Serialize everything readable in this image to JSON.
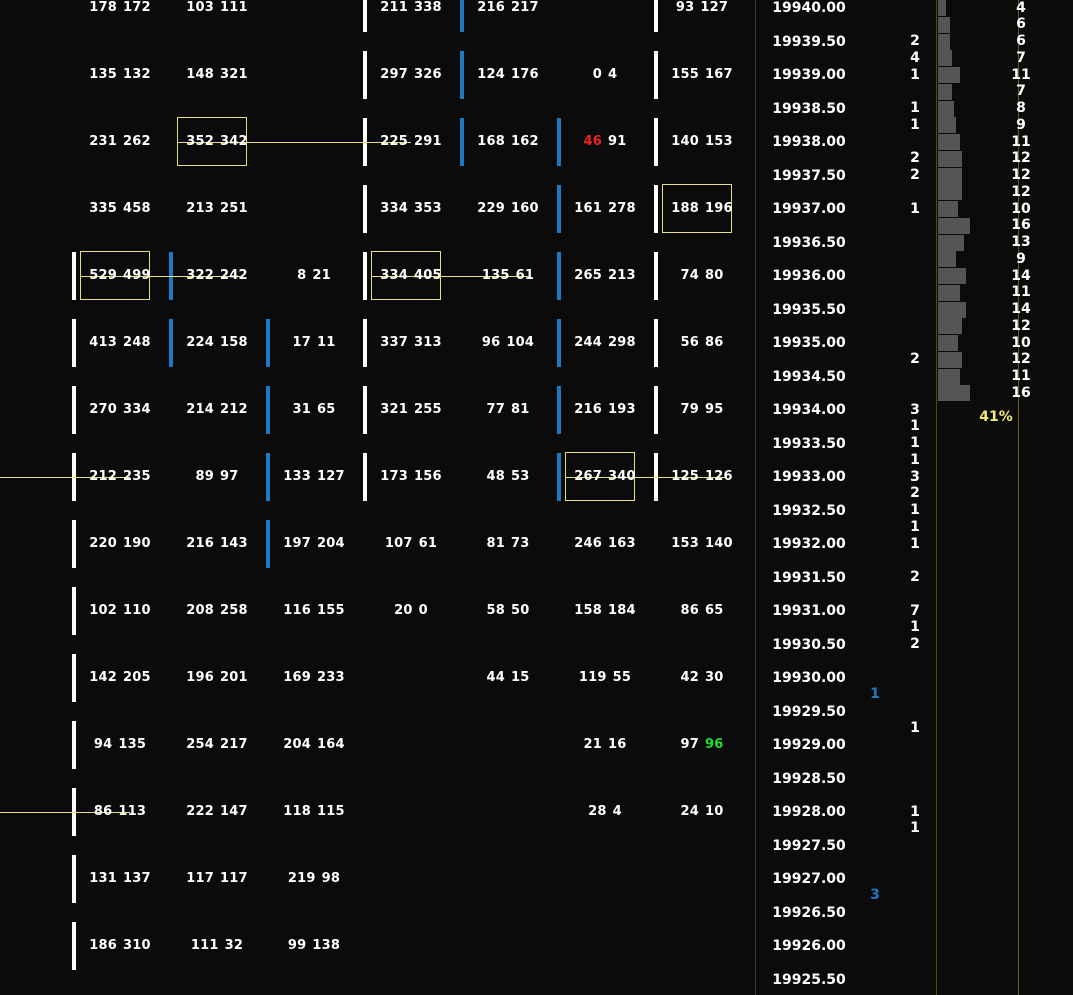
{
  "columns": [
    {
      "rows": [
        {
          "price": "19940.00",
          "bid": "178",
          "ask": "172"
        },
        {
          "price": "19939.00",
          "bid": "135",
          "ask": "132"
        },
        {
          "price": "19938.00",
          "bid": "231",
          "ask": "262"
        },
        {
          "price": "19937.00",
          "bid": "335",
          "ask": "458"
        },
        {
          "price": "19936.00",
          "bid": "529",
          "ask": "499",
          "box": true,
          "line_across": true,
          "bar": "white"
        },
        {
          "price": "19935.00",
          "bid": "413",
          "ask": "248",
          "bar": "white"
        },
        {
          "price": "19934.00",
          "bid": "270",
          "ask": "334",
          "bar": "white"
        },
        {
          "price": "19933.00",
          "bid": "212",
          "ask": "235",
          "bar": "white",
          "line_in": true
        },
        {
          "price": "19932.00",
          "bid": "220",
          "ask": "190",
          "bar": "white"
        },
        {
          "price": "19931.00",
          "bid": "102",
          "ask": "110",
          "bar": "white"
        },
        {
          "price": "19930.00",
          "bid": "142",
          "ask": "205",
          "bar": "white"
        },
        {
          "price": "19929.00",
          "bid": "94",
          "ask": "135",
          "bar": "white"
        },
        {
          "price": "19928.00",
          "bid": "86",
          "ask": "113",
          "bar": "white",
          "line_in": true
        },
        {
          "price": "19927.00",
          "bid": "131",
          "ask": "137",
          "bar": "white"
        },
        {
          "price": "19926.00",
          "bid": "186",
          "ask": "310",
          "bar": "white"
        }
      ]
    },
    {
      "rows": [
        {
          "price": "19940.00",
          "bid": "103",
          "ask": "111"
        },
        {
          "price": "19939.00",
          "bid": "148",
          "ask": "321"
        },
        {
          "price": "19938.00",
          "bid": "352",
          "ask": "342",
          "box": true,
          "line_across": true
        },
        {
          "price": "19937.00",
          "bid": "213",
          "ask": "251"
        },
        {
          "price": "19936.00",
          "bid": "322",
          "ask": "242",
          "bar": "blue",
          "line_in": true
        },
        {
          "price": "19935.00",
          "bid": "224",
          "ask": "158",
          "bar": "blue"
        },
        {
          "price": "19934.00",
          "bid": "214",
          "ask": "212"
        },
        {
          "price": "19933.00",
          "bid": "89",
          "ask": "97"
        },
        {
          "price": "19932.00",
          "bid": "216",
          "ask": "143"
        },
        {
          "price": "19931.00",
          "bid": "208",
          "ask": "258"
        },
        {
          "price": "19930.00",
          "bid": "196",
          "ask": "201"
        },
        {
          "price": "19929.00",
          "bid": "254",
          "ask": "217"
        },
        {
          "price": "19928.00",
          "bid": "222",
          "ask": "147"
        },
        {
          "price": "19927.00",
          "bid": "117",
          "ask": "117"
        },
        {
          "price": "19926.00",
          "bid": "111",
          "ask": "32"
        }
      ]
    },
    {
      "rows": [
        {
          "price": "19936.00",
          "bid": "8",
          "ask": "21"
        },
        {
          "price": "19935.00",
          "bid": "17",
          "ask": "11",
          "bar": "blue"
        },
        {
          "price": "19934.00",
          "bid": "31",
          "ask": "65",
          "bar": "blue"
        },
        {
          "price": "19933.00",
          "bid": "133",
          "ask": "127",
          "bar": "blue"
        },
        {
          "price": "19932.00",
          "bid": "197",
          "ask": "204",
          "bar": "blue"
        },
        {
          "price": "19931.00",
          "bid": "116",
          "ask": "155"
        },
        {
          "price": "19930.00",
          "bid": "169",
          "ask": "233"
        },
        {
          "price": "19929.00",
          "bid": "204",
          "ask": "164"
        },
        {
          "price": "19928.00",
          "bid": "118",
          "ask": "115"
        },
        {
          "price": "19927.00",
          "bid": "219",
          "ask": "98"
        },
        {
          "price": "19926.00",
          "bid": "99",
          "ask": "138"
        }
      ]
    },
    {
      "rows": [
        {
          "price": "19940.00",
          "bid": "211",
          "ask": "338",
          "bar": "white"
        },
        {
          "price": "19939.00",
          "bid": "297",
          "ask": "326",
          "bar": "white"
        },
        {
          "price": "19938.00",
          "bid": "225",
          "ask": "291",
          "bar": "white",
          "line_in": true
        },
        {
          "price": "19937.00",
          "bid": "334",
          "ask": "353",
          "bar": "white"
        },
        {
          "price": "19936.00",
          "bid": "334",
          "ask": "405",
          "box": true,
          "line_across": true,
          "bar": "white"
        },
        {
          "price": "19935.00",
          "bid": "337",
          "ask": "313",
          "bar": "white"
        },
        {
          "price": "19934.00",
          "bid": "321",
          "ask": "255",
          "bar": "white"
        },
        {
          "price": "19933.00",
          "bid": "173",
          "ask": "156",
          "bar": "white"
        },
        {
          "price": "19932.00",
          "bid": "107",
          "ask": "61"
        },
        {
          "price": "19931.00",
          "bid": "20",
          "ask": "0"
        }
      ]
    },
    {
      "rows": [
        {
          "price": "19940.00",
          "bid": "216",
          "ask": "217",
          "bar": "blue"
        },
        {
          "price": "19939.00",
          "bid": "124",
          "ask": "176",
          "bar": "blue"
        },
        {
          "price": "19938.00",
          "bid": "168",
          "ask": "162",
          "bar": "blue"
        },
        {
          "price": "19937.00",
          "bid": "229",
          "ask": "160"
        },
        {
          "price": "19936.00",
          "bid": "135",
          "ask": "61",
          "line_in": true
        },
        {
          "price": "19935.00",
          "bid": "96",
          "ask": "104"
        },
        {
          "price": "19934.00",
          "bid": "77",
          "ask": "81"
        },
        {
          "price": "19933.00",
          "bid": "48",
          "ask": "53"
        },
        {
          "price": "19932.00",
          "bid": "81",
          "ask": "73"
        },
        {
          "price": "19931.00",
          "bid": "58",
          "ask": "50"
        },
        {
          "price": "19930.00",
          "bid": "44",
          "ask": "15"
        }
      ]
    },
    {
      "rows": [
        {
          "price": "19939.00",
          "bid": "0",
          "ask": "4"
        },
        {
          "price": "19938.00",
          "bid": "46",
          "ask": "91",
          "bar": "blue",
          "bid_color": "#e8261f"
        },
        {
          "price": "19937.00",
          "bid": "161",
          "ask": "278",
          "bar": "blue"
        },
        {
          "price": "19936.00",
          "bid": "265",
          "ask": "213",
          "bar": "blue"
        },
        {
          "price": "19935.00",
          "bid": "244",
          "ask": "298",
          "bar": "blue"
        },
        {
          "price": "19934.00",
          "bid": "216",
          "ask": "193",
          "bar": "blue"
        },
        {
          "price": "19933.00",
          "bid": "267",
          "ask": "340",
          "box": true,
          "line_across": true,
          "bar": "blue"
        },
        {
          "price": "19932.00",
          "bid": "246",
          "ask": "163"
        },
        {
          "price": "19931.00",
          "bid": "158",
          "ask": "184"
        },
        {
          "price": "19930.00",
          "bid": "119",
          "ask": "55"
        },
        {
          "price": "19929.00",
          "bid": "21",
          "ask": "16"
        },
        {
          "price": "19928.00",
          "bid": "28",
          "ask": "4"
        }
      ]
    },
    {
      "rows": [
        {
          "price": "19940.00",
          "bid": "93",
          "ask": "127",
          "bar": "white"
        },
        {
          "price": "19939.00",
          "bid": "155",
          "ask": "167",
          "bar": "white"
        },
        {
          "price": "19938.00",
          "bid": "140",
          "ask": "153",
          "bar": "white"
        },
        {
          "price": "19937.00",
          "bid": "188",
          "ask": "196",
          "box": true,
          "bar": "white"
        },
        {
          "price": "19936.00",
          "bid": "74",
          "ask": "80",
          "bar": "white"
        },
        {
          "price": "19935.00",
          "bid": "56",
          "ask": "86",
          "bar": "white"
        },
        {
          "price": "19934.00",
          "bid": "79",
          "ask": "95",
          "bar": "white"
        },
        {
          "price": "19933.00",
          "bid": "125",
          "ask": "126",
          "bar": "white",
          "line_in": true
        },
        {
          "price": "19932.00",
          "bid": "153",
          "ask": "140"
        },
        {
          "price": "19931.00",
          "bid": "86",
          "ask": "65"
        },
        {
          "price": "19930.00",
          "bid": "42",
          "ask": "30"
        },
        {
          "price": "19929.00",
          "bid": "97",
          "ask": "96",
          "ask_color": "#22e02a"
        },
        {
          "price": "19928.00",
          "bid": "24",
          "ask": "10"
        }
      ]
    }
  ],
  "price_ladder": [
    "19940.00",
    "19939.50",
    "19939.00",
    "19938.50",
    "19938.00",
    "19937.50",
    "19937.00",
    "19936.50",
    "19936.00",
    "19935.50",
    "19935.00",
    "19934.50",
    "19934.00",
    "19933.50",
    "19933.00",
    "19932.50",
    "19932.00",
    "19931.50",
    "19931.00",
    "19930.50",
    "19930.00",
    "19929.50",
    "19929.00",
    "19928.50",
    "19928.00",
    "19927.50",
    "19927.00",
    "19926.50",
    "19926.00",
    "19925.50"
  ],
  "tick_prices": [
    "19940.00",
    "19939.75",
    "19939.50",
    "19939.25",
    "19939.00",
    "19938.75",
    "19938.50",
    "19938.25",
    "19938.00",
    "19937.75",
    "19937.50",
    "19937.25",
    "19937.00",
    "19936.75",
    "19936.50",
    "19936.25",
    "19936.00",
    "19935.75",
    "19935.50",
    "19935.25",
    "19935.00",
    "19934.75",
    "19934.50",
    "19934.25",
    "19934.00",
    "19933.75",
    "19933.50",
    "19933.25",
    "19933.00",
    "19932.75",
    "19932.50",
    "19932.25",
    "19932.00",
    "19931.75",
    "19931.50",
    "19931.25",
    "19931.00",
    "19930.75",
    "19930.50",
    "19930.25",
    "19930.00",
    "19929.75",
    "19929.50",
    "19929.25",
    "19929.00",
    "19928.75",
    "19928.50",
    "19928.25",
    "19928.00",
    "19927.75",
    "19927.50",
    "19927.25",
    "19927.00",
    "19926.75",
    "19926.50",
    "19926.25",
    "19926.00",
    "19925.75",
    "19925.50",
    "19925.25"
  ],
  "trade_counts": [
    {
      "price": "19939.50",
      "value": "2"
    },
    {
      "price": "19939.25",
      "value": "4"
    },
    {
      "price": "19939.00",
      "value": "1"
    },
    {
      "price": "19938.50",
      "value": "1"
    },
    {
      "price": "19938.25",
      "value": "1"
    },
    {
      "price": "19937.75",
      "value": "2"
    },
    {
      "price": "19937.50",
      "value": "2"
    },
    {
      "price": "19937.00",
      "value": "1"
    },
    {
      "price": "19934.75",
      "value": "2"
    },
    {
      "price": "19934.00",
      "value": "3"
    },
    {
      "price": "19933.75",
      "value": "1"
    },
    {
      "price": "19933.50",
      "value": "1"
    },
    {
      "price": "19933.25",
      "value": "1"
    },
    {
      "price": "19933.00",
      "value": "3"
    },
    {
      "price": "19932.75",
      "value": "2"
    },
    {
      "price": "19932.50",
      "value": "1"
    },
    {
      "price": "19932.25",
      "value": "1"
    },
    {
      "price": "19932.00",
      "value": "1"
    },
    {
      "price": "19931.50",
      "value": "2"
    },
    {
      "price": "19931.00",
      "value": "7"
    },
    {
      "price": "19930.75",
      "value": "1"
    },
    {
      "price": "19930.50",
      "value": "2"
    },
    {
      "price": "19929.25",
      "value": "1"
    },
    {
      "price": "19928.00",
      "value": "1"
    },
    {
      "price": "19927.75",
      "value": "1"
    }
  ],
  "blue_markers": [
    {
      "price": "19929.75",
      "value": "1"
    },
    {
      "price": "19926.75",
      "value": "3"
    }
  ],
  "tpo_profile": [
    {
      "price": "19940.00",
      "count": "4"
    },
    {
      "price": "19939.75",
      "count": "6"
    },
    {
      "price": "19939.50",
      "count": "6"
    },
    {
      "price": "19939.25",
      "count": "7"
    },
    {
      "price": "19939.00",
      "count": "11"
    },
    {
      "price": "19938.75",
      "count": "7"
    },
    {
      "price": "19938.50",
      "count": "8"
    },
    {
      "price": "19938.25",
      "count": "9"
    },
    {
      "price": "19938.00",
      "count": "11"
    },
    {
      "price": "19937.75",
      "count": "12"
    },
    {
      "price": "19937.50",
      "count": "12"
    },
    {
      "price": "19937.25",
      "count": "12"
    },
    {
      "price": "19937.00",
      "count": "10"
    },
    {
      "price": "19936.75",
      "count": "16"
    },
    {
      "price": "19936.50",
      "count": "13"
    },
    {
      "price": "19936.25",
      "count": "9"
    },
    {
      "price": "19936.00",
      "count": "14"
    },
    {
      "price": "19935.75",
      "count": "11"
    },
    {
      "price": "19935.50",
      "count": "14"
    },
    {
      "price": "19935.25",
      "count": "12"
    },
    {
      "price": "19935.00",
      "count": "10"
    },
    {
      "price": "19934.75",
      "count": "12"
    },
    {
      "price": "19934.50",
      "count": "11"
    },
    {
      "price": "19934.25",
      "count": "16"
    }
  ],
  "value_area_percent": "41%",
  "colors": {
    "background": "#0b0b0b",
    "text": "#ffffff",
    "accent_blue": "#1e78c2",
    "highlight_yellow": "#e6e07a",
    "profile_gray": "#555555",
    "percent_yellow": "#f2ea6f",
    "sell_red": "#e8261f",
    "buy_green": "#22e02a"
  }
}
